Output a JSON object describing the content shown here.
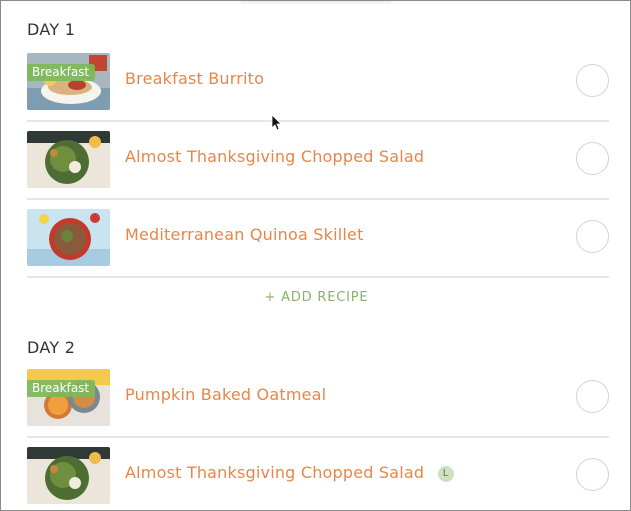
{
  "days": [
    {
      "label": "DAY 1",
      "add_recipe_label": "+ ADD RECIPE",
      "recipes": [
        {
          "title": "Breakfast Burrito",
          "badge": "Breakfast",
          "tag": ""
        },
        {
          "title": "Almost Thanksgiving Chopped Salad",
          "badge": "",
          "tag": ""
        },
        {
          "title": "Mediterranean Quinoa Skillet",
          "badge": "",
          "tag": ""
        }
      ]
    },
    {
      "label": "DAY 2",
      "recipes": [
        {
          "title": "Pumpkin Baked Oatmeal",
          "badge": "Breakfast",
          "tag": ""
        },
        {
          "title": "Almost Thanksgiving Chopped Salad",
          "badge": "",
          "tag": "L"
        }
      ]
    }
  ],
  "colors": {
    "accent": "#e8864a",
    "badge_green": "#7eb85a",
    "add_recipe_green": "#8ab36a",
    "divider": "#e6e6e6"
  },
  "icons": {
    "check": "checkbox-circle-icon",
    "cursor": "mouse-pointer-icon"
  }
}
